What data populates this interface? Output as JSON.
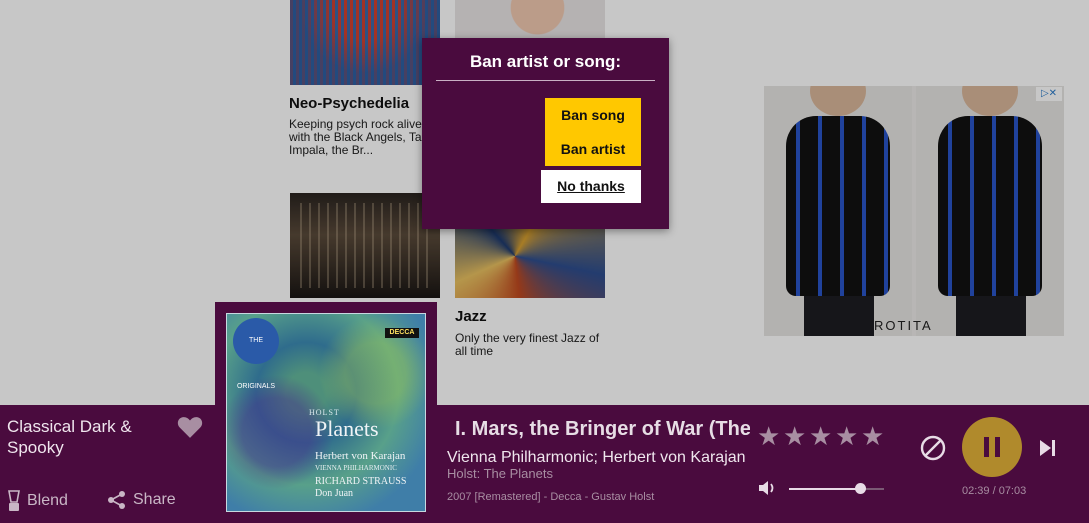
{
  "tiles": [
    {
      "title": "Neo-Psychedelia",
      "description": "Keeping psych rock alive with the Black Angels, Tame Impala, the Br..."
    },
    {
      "title": "Jazz",
      "description": "Only the very finest Jazz of all time"
    }
  ],
  "ad": {
    "brand": "ROTITA",
    "choice_label": "▷✕"
  },
  "modal": {
    "title": "Ban artist or song:",
    "ban_song_label": "Ban song",
    "ban_artist_label": "Ban artist",
    "no_thanks_label": "No thanks"
  },
  "player": {
    "station_name": "Classical Dark & Spooky",
    "blend_label": "Blend",
    "share_label": "Share",
    "track_title": "I. Mars, the Bringer of War (The Planets)",
    "track_artist": "Vienna Philharmonic; Herbert von Karajan",
    "track_album": "Holst: The Planets",
    "track_meta": "2007 [Remastered] - Decca - Gustav Holst",
    "rating_stars": 5,
    "rating_value": 0,
    "volume_level": 0.75,
    "time_display": "02:39 / 07:03",
    "colors": {
      "bar_bg": "#4a0b3e",
      "accent": "#b08a2c",
      "muted": "#a88ea2"
    }
  },
  "album_art": {
    "label": "DECCA",
    "badge": "THE ORIGINALS",
    "subtitle": "HOLST",
    "title": "Planets",
    "credit_1": "Herbert von Karajan",
    "credit_2": "VIENNA PHILHARMONIC",
    "credit_3": "RICHARD STRAUSS",
    "credit_4": "Don Juan"
  },
  "icons": [
    "heart-icon",
    "blender-icon",
    "share-icon",
    "star-icon",
    "volume-icon",
    "ban-icon",
    "pause-icon",
    "skip-next-icon"
  ]
}
